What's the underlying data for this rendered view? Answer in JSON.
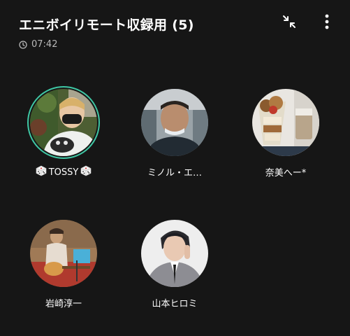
{
  "header": {
    "title": "エニボイリモート収録用 (5)",
    "timer_icon": "clock-icon",
    "elapsed": "07:42",
    "minimize_icon": "collapse-arrows-icon",
    "more_icon": "more-vertical-icon"
  },
  "colors": {
    "background": "#161616",
    "speaking_ring": "#3fc7a4",
    "secondary_text": "#b9b9b9"
  },
  "participants": [
    {
      "name": "TOSSY",
      "prefix_icon": "dice-icon",
      "suffix_icon": "dice-icon",
      "speaking": true
    },
    {
      "name": "ミノル・エ…",
      "speaking": false
    },
    {
      "name": "奈美へー*",
      "speaking": false
    },
    {
      "name": "岩崎淳一",
      "speaking": false
    },
    {
      "name": "山本ヒロミ",
      "speaking": false
    }
  ]
}
